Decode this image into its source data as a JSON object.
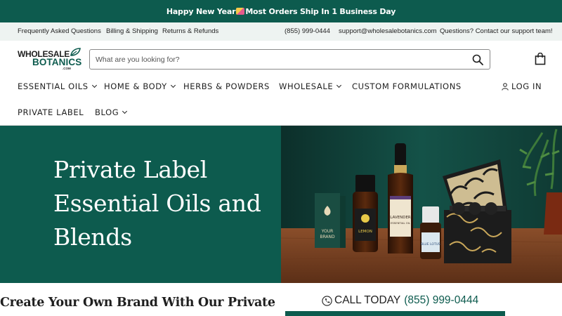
{
  "announcement": {
    "before": "Happy New Year",
    "after": "Most Orders Ship In 1 Business Day",
    "emoji_icon": "party-popper-icon"
  },
  "utility": {
    "faq": "Frequently Asked Questions",
    "billing": "Billing & Shipping",
    "returns": "Returns & Refunds",
    "phone": "(855) 999-0444",
    "email": "support@wholesalebotanics.com",
    "contact": "Questions? Contact our support team!"
  },
  "logo": {
    "line1": "WHOLESALE",
    "line2": "BOTANICS",
    "line3": ".COM"
  },
  "search": {
    "placeholder": "What are you looking for?",
    "value": ""
  },
  "nav": {
    "essential_oils": "ESSENTIAL OILS",
    "home_body": "HOME & BODY",
    "herbs": "HERBS & POWDERS",
    "wholesale": "WHOLESALE",
    "custom": "CUSTOM FORMULATIONS",
    "login": "LOG IN",
    "private_label": "PRIVATE LABEL",
    "blog": "BLOG"
  },
  "hero": {
    "title": "Private Label Essential Oils and Blends",
    "box_text_1": "YOUR",
    "box_text_2": "BRAND",
    "bottle_lemon": "LEMON",
    "bottle_lavender_1": "LAVENDER",
    "bottle_lavender_2": "ESSENTIAL OIL",
    "bottle_blue": "BLUE LOTUS"
  },
  "below": {
    "heading": "Create Your Own Brand With Our Private",
    "call_label": "CALL TODAY",
    "call_number": "(855) 999-0444"
  },
  "colors": {
    "brand_green": "#0d5b4e",
    "utility_bg": "#eef3f1"
  }
}
